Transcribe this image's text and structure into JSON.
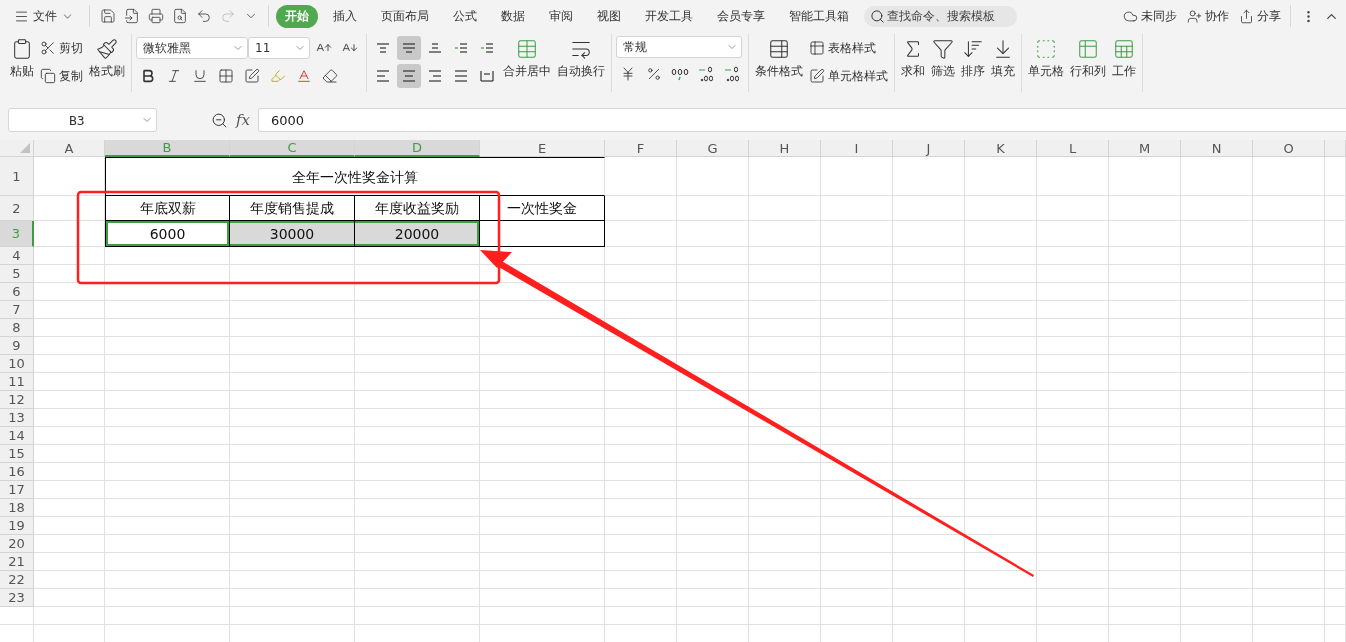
{
  "menu_bar": {
    "file_menu": "文件",
    "tabs": [
      {
        "label": "开始",
        "selected": true
      },
      {
        "label": "插入",
        "selected": false
      },
      {
        "label": "页面布局",
        "selected": false
      },
      {
        "label": "公式",
        "selected": false
      },
      {
        "label": "数据",
        "selected": false
      },
      {
        "label": "审阅",
        "selected": false
      },
      {
        "label": "视图",
        "selected": false
      },
      {
        "label": "开发工具",
        "selected": false
      },
      {
        "label": "会员专享",
        "selected": false
      },
      {
        "label": "智能工具箱",
        "selected": false
      }
    ],
    "search": {
      "placeholder": "查找命令、搜索模板"
    },
    "actions": [
      "未同步",
      "协作",
      "分享"
    ]
  },
  "ribbon": {
    "clipboard": {
      "paste": "粘贴",
      "cut": "剪切",
      "copy": "复制",
      "format_painter": "格式刷"
    },
    "font": {
      "name": "微软雅黑",
      "size": "11"
    },
    "alignment": {
      "buttons": [
        {
          "selected": false
        },
        {
          "selected": true
        },
        {
          "selected": false
        },
        {
          "selected": false
        },
        {
          "selected": false
        },
        {
          "selected": false
        },
        {
          "selected": true
        },
        {
          "selected": false
        },
        {
          "selected": false
        },
        {
          "selected": false
        }
      ],
      "merge": "合并居中",
      "wrap": "自动换行"
    },
    "number": {
      "format": "常规"
    },
    "styles": {
      "conditional": "条件格式",
      "table_style": "表格样式",
      "cell_style": "单元格样式"
    },
    "editing": [
      "求和",
      "筛选",
      "排序",
      "填充"
    ],
    "cells": [
      "单元格",
      "行和列",
      "工作"
    ]
  },
  "formula_bar": {
    "name_box": "B3",
    "function_label": "fx",
    "formula": "6000"
  },
  "sheet": {
    "columns": [
      {
        "label": "A",
        "selected": false
      },
      {
        "label": "B",
        "selected": true
      },
      {
        "label": "C",
        "selected": true
      },
      {
        "label": "D",
        "selected": true
      },
      {
        "label": "E",
        "selected": false
      },
      {
        "label": "F",
        "selected": false
      },
      {
        "label": "G",
        "selected": false
      },
      {
        "label": "H",
        "selected": false
      },
      {
        "label": "I",
        "selected": false
      },
      {
        "label": "J",
        "selected": false
      },
      {
        "label": "K",
        "selected": false
      },
      {
        "label": "L",
        "selected": false
      },
      {
        "label": "M",
        "selected": false
      },
      {
        "label": "N",
        "selected": false
      },
      {
        "label": "O",
        "selected": false
      }
    ],
    "rows": [
      {
        "label": "1",
        "selected": false
      },
      {
        "label": "2",
        "selected": false
      },
      {
        "label": "3",
        "selected": true
      },
      {
        "label": "4",
        "selected": false
      },
      {
        "label": "5",
        "selected": false
      },
      {
        "label": "6",
        "selected": false
      },
      {
        "label": "7",
        "selected": false
      },
      {
        "label": "8",
        "selected": false
      },
      {
        "label": "9",
        "selected": false
      },
      {
        "label": "10",
        "selected": false
      },
      {
        "label": "11",
        "selected": false
      },
      {
        "label": "12",
        "selected": false
      },
      {
        "label": "13",
        "selected": false
      },
      {
        "label": "14",
        "selected": false
      },
      {
        "label": "15",
        "selected": false
      },
      {
        "label": "16",
        "selected": false
      },
      {
        "label": "17",
        "selected": false
      },
      {
        "label": "18",
        "selected": false
      },
      {
        "label": "19",
        "selected": false
      },
      {
        "label": "20",
        "selected": false
      },
      {
        "label": "21",
        "selected": false
      },
      {
        "label": "22",
        "selected": false
      },
      {
        "label": "23",
        "selected": false
      }
    ],
    "table": {
      "title": "全年一次性奖金计算",
      "header_cells": [
        "年底双薪",
        "年度销售提成",
        "年度收益奖励",
        "一次性奖金"
      ],
      "value_cells": [
        {
          "text": "6000",
          "selected": true,
          "active": true
        },
        {
          "text": "30000",
          "selected": true,
          "active": false
        },
        {
          "text": "20000",
          "selected": true,
          "active": false
        }
      ]
    }
  }
}
